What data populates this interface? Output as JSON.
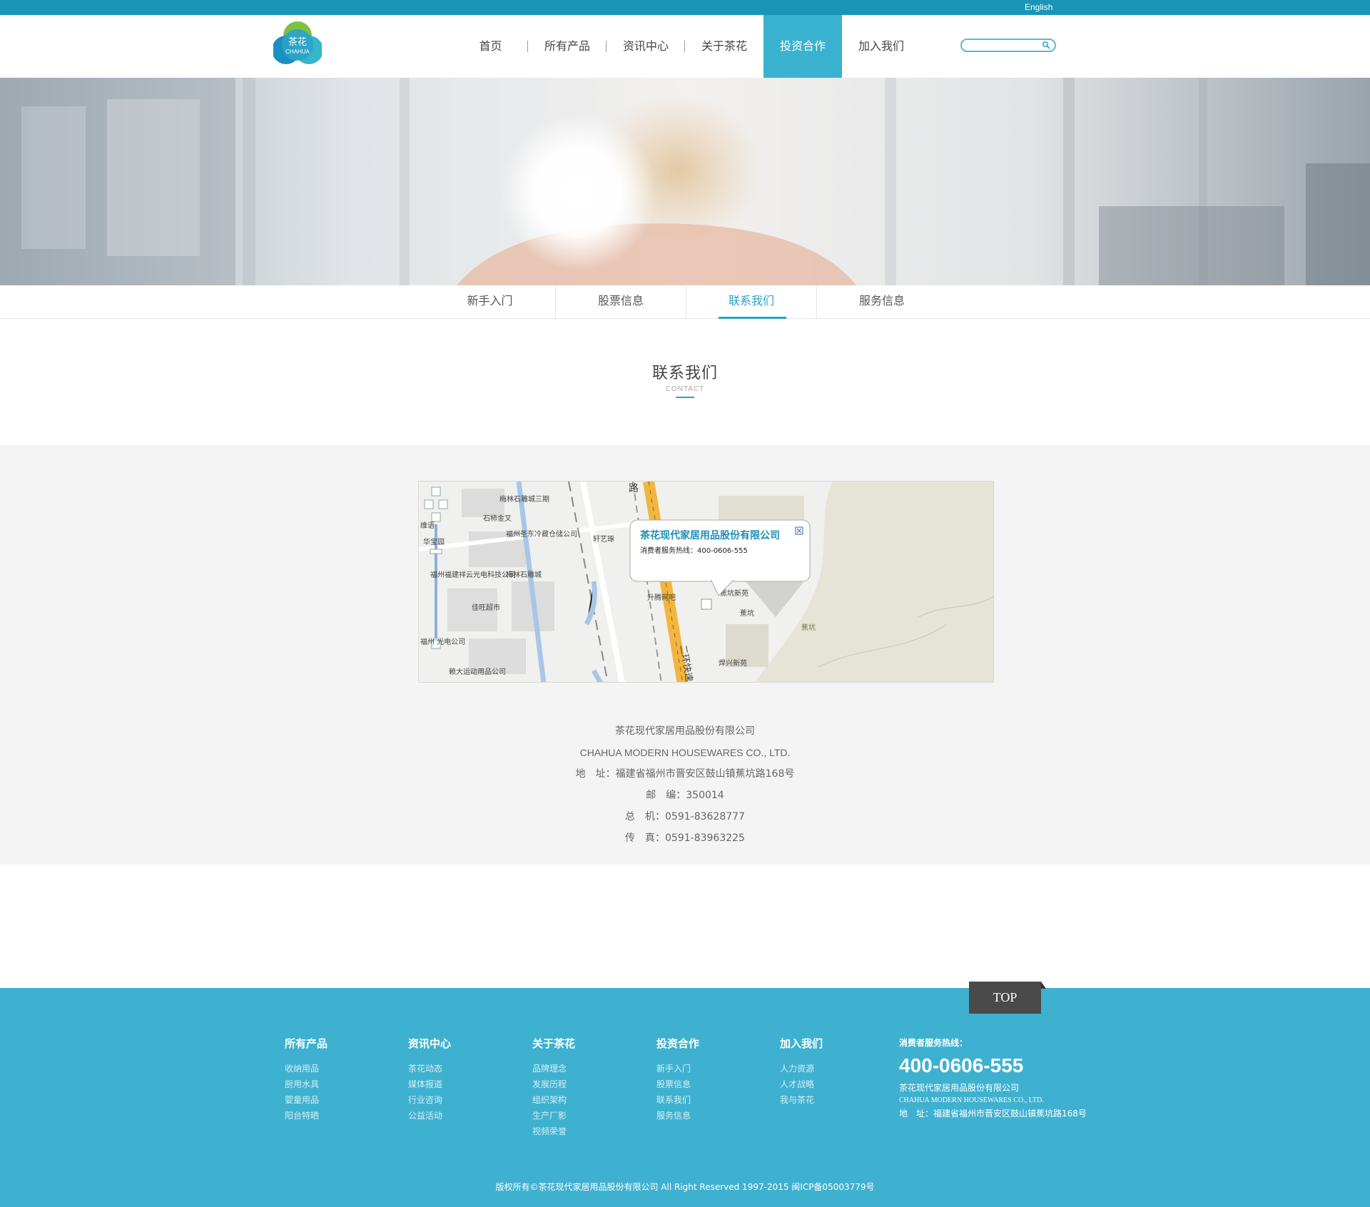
{
  "topbar": {
    "language": "English"
  },
  "logo": {
    "zh": "茶花",
    "en": "CHAHUA"
  },
  "nav": [
    {
      "label": "首页"
    },
    {
      "label": "所有产品"
    },
    {
      "label": "资讯中心"
    },
    {
      "label": "关于茶花"
    },
    {
      "label": "投资合作",
      "active": true
    },
    {
      "label": "加入我们"
    }
  ],
  "search": {
    "placeholder": ""
  },
  "subnav": [
    {
      "label": "新手入门"
    },
    {
      "label": "股票信息"
    },
    {
      "label": "联系我们",
      "active": true
    },
    {
      "label": "服务信息"
    }
  ],
  "section": {
    "title": "联系我们",
    "subtitle": "CONTACT"
  },
  "map": {
    "popup_title": "茶花现代家居用品股份有限公司",
    "popup_text": "消费者服务热线：400-0606-555",
    "labels": [
      "路",
      "梅林石雕城三期",
      "石柿金叉",
      "福州圣东冷藏仓储公司",
      "轩艺琢",
      "维语",
      "华宝园",
      "福州福建祥云光电科技公司",
      "梅林石雕城",
      "佳旺超市",
      "升腾网吧",
      "蕉坑新苑",
      "蕉坑",
      "二环快速",
      "焊兴新苑",
      "福州 光电公司",
      "赖大运动用品公司",
      "蕉坑"
    ]
  },
  "contact": {
    "company_zh": "茶花现代家居用品股份有限公司",
    "company_en": "CHAHUA MODERN HOUSEWARES CO., LTD.",
    "address": "地　址：福建省福州市晋安区鼓山镇蕉坑路168号",
    "postcode": "邮　编：350014",
    "phone": "总　机：0591-83628777",
    "fax": "传　真：0591-83963225"
  },
  "top_button": "TOP",
  "footer": {
    "columns": [
      {
        "title": "所有产品",
        "links": [
          "收纳用品",
          "厨用水具",
          "婴童用品",
          "阳台特晒"
        ]
      },
      {
        "title": "资讯中心",
        "links": [
          "茶花动态",
          "媒体报道",
          "行业咨询",
          "公益活动"
        ]
      },
      {
        "title": "关于茶花",
        "links": [
          "品牌理念",
          "发展历程",
          "组织架构",
          "生产厂影",
          "视频荣誉"
        ]
      },
      {
        "title": "投资合作",
        "links": [
          "新手入门",
          "股票信息",
          "联系我们",
          "服务信息"
        ]
      },
      {
        "title": "加入我们",
        "links": [
          "人力资源",
          "人才战略",
          "我与茶花"
        ]
      }
    ],
    "hotline_label": "消费者服务热线：",
    "hotline_number": "400-0606-555",
    "company_zh": "茶花现代家居用品股份有限公司",
    "company_en": "CHAHUA MODERN HOUSEWARES CO., LTD.",
    "address": "地　址：福建省福州市晋安区鼓山镇蕉坑路168号",
    "copyright": "版权所有©茶花现代家居用品股份有限公司 All Right Reserved 1997-2015 闽ICP备05003779号"
  }
}
